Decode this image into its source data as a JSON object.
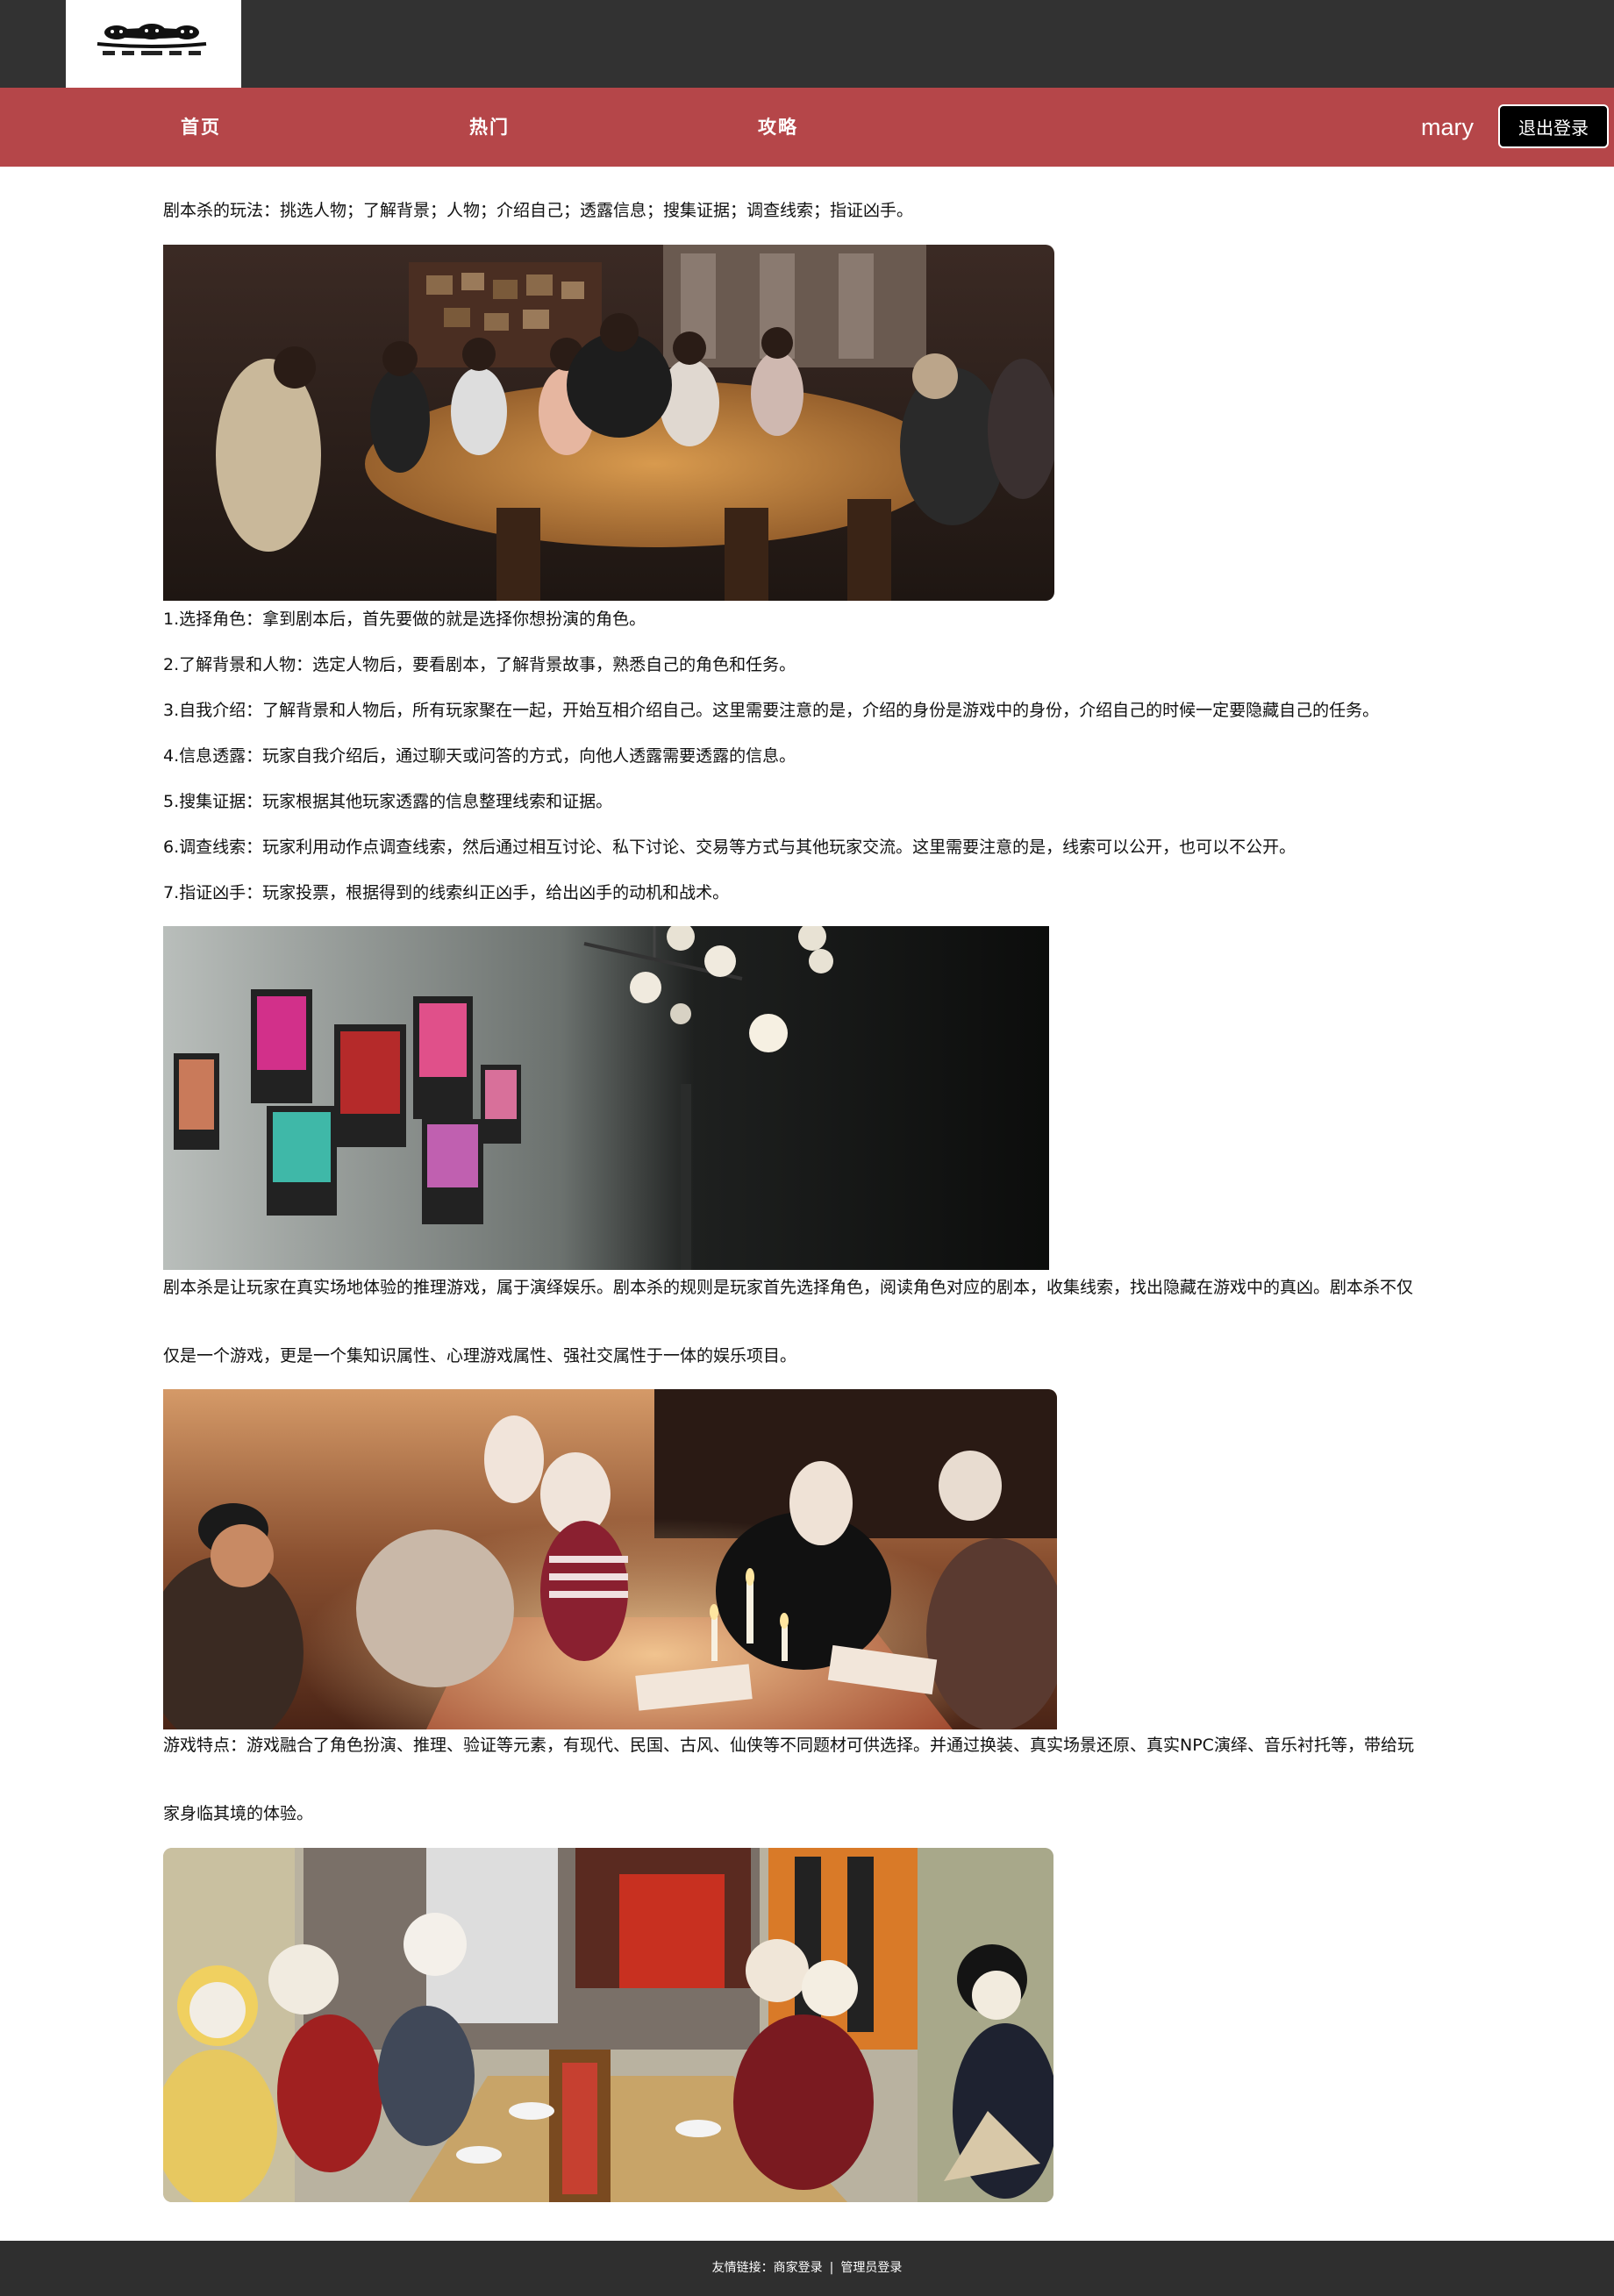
{
  "header": {
    "logo_icon": "masked-figures-logo",
    "nav": [
      {
        "label": "首页"
      },
      {
        "label": "热门"
      },
      {
        "label": "攻略"
      }
    ],
    "username": "mary",
    "logout_label": "退出登录",
    "colors": {
      "topbar": "#323232",
      "navbar": "#b54649",
      "footer": "#2f2f2f"
    }
  },
  "article": {
    "intro": "剧本杀的玩法：挑选人物；了解背景；人物；介绍自己；透露信息；搜集证据；调查线索；指证凶手。",
    "steps": [
      "1.选择角色：拿到剧本后，首先要做的就是选择你想扮演的角色。",
      "2.了解背景和人物：选定人物后，要看剧本，了解背景故事，熟悉自己的角色和任务。",
      "3.自我介绍：了解背景和人物后，所有玩家聚在一起，开始互相介绍自己。这里需要注意的是，介绍的身份是游戏中的身份，介绍自己的时候一定要隐藏自己的任务。",
      "4.信息透露：玩家自我介绍后，通过聊天或问答的方式，向他人透露需要透露的信息。",
      "5.搜集证据：玩家根据其他玩家透露的信息整理线索和证据。",
      "6.调查线索：玩家利用动作点调查线索，然后通过相互讨论、私下讨论、交易等方式与其他玩家交流。这里需要注意的是，线索可以公开，也可以不公开。",
      "7.指证凶手：玩家投票，根据得到的线索纠正凶手，给出凶手的动机和战术。"
    ],
    "para2_a": "剧本杀是让玩家在真实场地体验的推理游戏，属于演绎娱乐。剧本杀的规则是玩家首先选择角色，阅读角色对应的剧本，收集线索，找出隐藏在游戏中的真凶。剧本杀不仅",
    "para2_b": "仅是一个游戏，更是一个集知识属性、心理游戏属性、强社交属性于一体的娱乐项目。",
    "para3_a": "游戏特点：游戏融合了角色扮演、推理、验证等元素，有现代、民国、古风、仙侠等不同题材可供选择。并通过换装、真实场景还原、真实NPC演绎、音乐衬托等，带给玩",
    "para3_b": "家身临其境的体验。",
    "photos": [
      "players-around-table-photo",
      "character-posters-wall-photo",
      "masked-players-candlelight-photo",
      "costumed-players-cat-faces-photo"
    ]
  },
  "footer": {
    "prefix": "友情链接：",
    "links": [
      {
        "label": "商家登录"
      },
      {
        "label": "管理员登录"
      }
    ],
    "separator": "|"
  }
}
